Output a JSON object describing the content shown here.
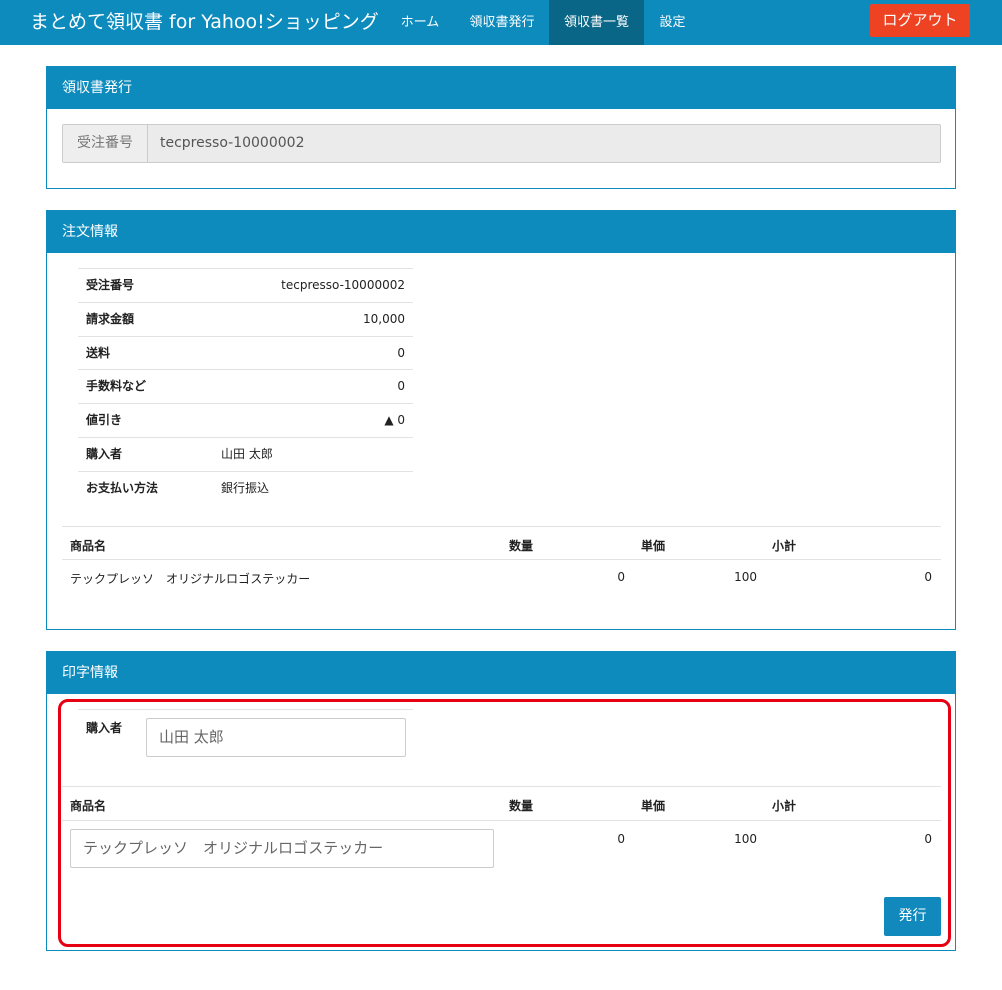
{
  "nav": {
    "brand": "まとめて領収書 for Yahoo!ショッピング",
    "items": [
      "ホーム",
      "領収書発行",
      "領収書一覧",
      "設定"
    ],
    "active": "領収書一覧",
    "logout": "ログアウト"
  },
  "issue_panel": {
    "title": "領収書発行",
    "order_label": "受注番号",
    "order_value": "tecpresso-10000002"
  },
  "order_panel": {
    "title": "注文情報",
    "rows": [
      {
        "key": "受注番号",
        "value": "tecpresso-10000002"
      },
      {
        "key": "請求金額",
        "value": "10,000"
      },
      {
        "key": "送料",
        "value": "0"
      },
      {
        "key": "手数料など",
        "value": "0"
      },
      {
        "key": "値引き",
        "value": "▲ 0"
      },
      {
        "key": "購入者",
        "value": "山田 太郎"
      },
      {
        "key": "お支払い方法",
        "value": "銀行振込"
      }
    ],
    "items_header": {
      "name": "商品名",
      "qty": "数量",
      "price": "単価",
      "subtotal": "小計"
    },
    "items": [
      {
        "name": "テックプレッソ　オリジナルロゴステッカー",
        "qty": "0",
        "price": "100",
        "subtotal": "0"
      }
    ]
  },
  "print_panel": {
    "title": "印字情報",
    "buyer_label": "購入者",
    "buyer_value": "山田 太郎",
    "items_header": {
      "name": "商品名",
      "qty": "数量",
      "price": "単価",
      "subtotal": "小計"
    },
    "item": {
      "name": "テックプレッソ　オリジナルロゴステッカー",
      "qty": "0",
      "price": "100",
      "subtotal": "0"
    },
    "issue_button": "発行"
  },
  "colors": {
    "primary": "#0d8bbd",
    "nav_active": "#0a6686",
    "logout": "#ee4322",
    "highlight": "#e60012"
  }
}
